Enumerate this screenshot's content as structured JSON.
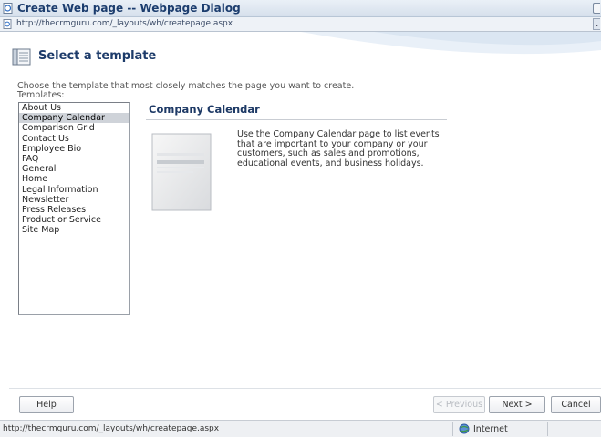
{
  "window": {
    "title": "Create Web page -- Webpage Dialog",
    "address": "http://thecrmguru.com/_layouts/wh/createpage.aspx"
  },
  "header": {
    "title": "Select a template"
  },
  "content": {
    "instruction": "Choose the template that most closely matches the page you want to create.",
    "templates_label": "Templates:",
    "templates": [
      "About Us",
      "Company Calendar",
      "Comparison Grid",
      "Contact Us",
      "Employee Bio",
      "FAQ",
      "General",
      "Home",
      "Legal Information",
      "Newsletter",
      "Press Releases",
      "Product or Service",
      "Site Map"
    ],
    "selected_index": 1,
    "preview": {
      "title": "Company Calendar",
      "description": "Use the Company Calendar page to list events that are important to your company or your customers, such as sales and promotions, educational events, and business holidays."
    }
  },
  "buttons": {
    "help": "Help",
    "previous": "< Previous",
    "next": "Next >",
    "cancel": "Cancel"
  },
  "status": {
    "url": "http://thecrmguru.com/_layouts/wh/createpage.aspx",
    "zone": "Internet"
  },
  "colors": {
    "header_title": "#1d3b6a",
    "selected_row": "#cfd3d9",
    "titlebar": "#d6e0ec"
  },
  "icons": {
    "titlebar": "ie-page-icon",
    "address": "page-icon",
    "header": "template-page-icon",
    "status_zone": "globe-icon"
  }
}
